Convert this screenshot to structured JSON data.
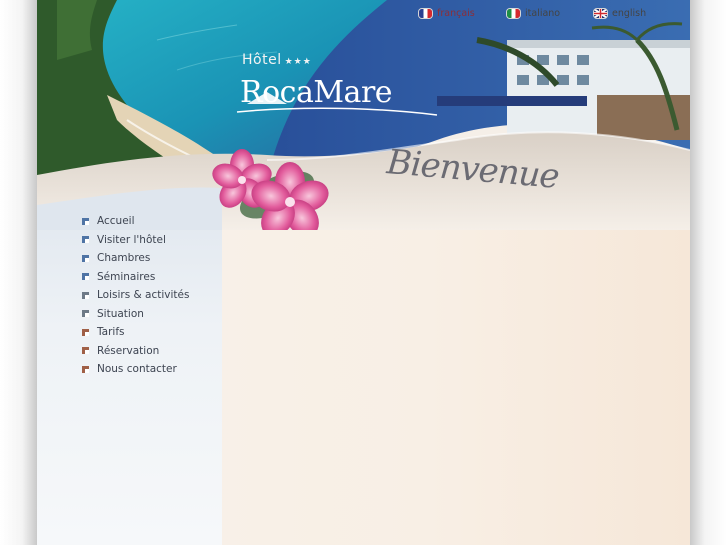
{
  "languages": [
    {
      "label": "français",
      "icon": "france-flag-icon",
      "active": true
    },
    {
      "label": "italiano",
      "icon": "italy-flag-icon",
      "active": false
    },
    {
      "label": "english",
      "icon": "uk-flag-icon",
      "active": false
    }
  ],
  "brand": {
    "hotel": "Hôtel",
    "stars": "★★★",
    "name": "RocaMare"
  },
  "greeting": "Bienvenue",
  "nav": {
    "items": [
      {
        "label": "Accueil"
      },
      {
        "label": "Visiter l'hôtel"
      },
      {
        "label": "Chambres"
      },
      {
        "label": "Séminaires"
      },
      {
        "label": "Loisirs & activités"
      },
      {
        "label": "Situation"
      },
      {
        "label": "Tarifs"
      },
      {
        "label": "Réservation"
      },
      {
        "label": "Nous contacter"
      }
    ]
  },
  "colors": {
    "sea": "#1aa0b4",
    "sky": "#2b4f93",
    "flower": "#e05a9a",
    "nav_text": "#3d4451"
  }
}
